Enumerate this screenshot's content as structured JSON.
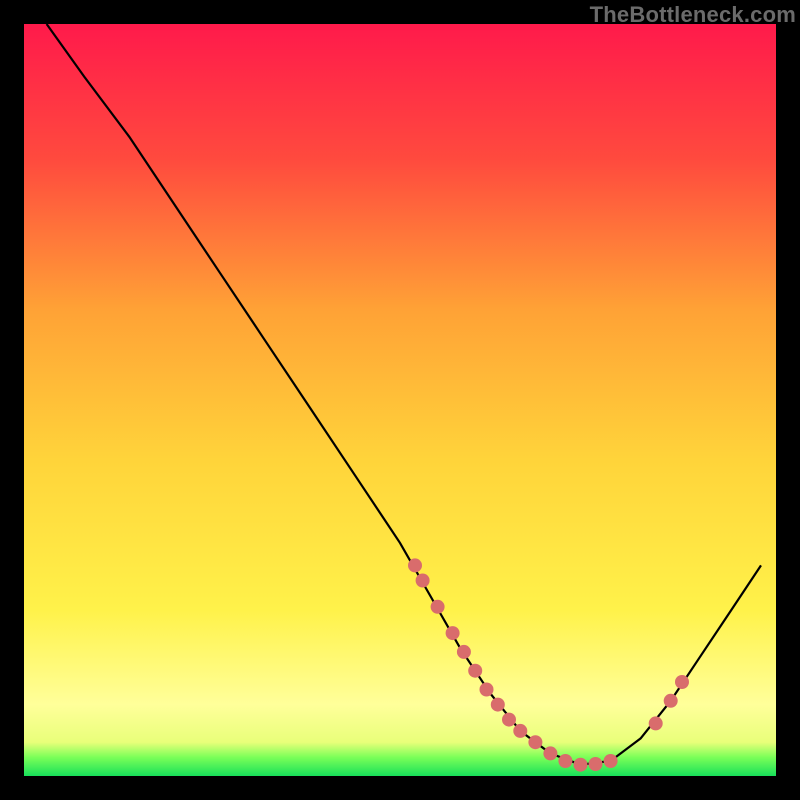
{
  "watermark": "TheBottleneck.com",
  "colors": {
    "gradient_stops": [
      {
        "offset": 0.0,
        "color": "#ff1a4b"
      },
      {
        "offset": 0.18,
        "color": "#ff4a3e"
      },
      {
        "offset": 0.38,
        "color": "#ffa236"
      },
      {
        "offset": 0.58,
        "color": "#ffd43a"
      },
      {
        "offset": 0.78,
        "color": "#fff24a"
      },
      {
        "offset": 0.905,
        "color": "#ffff9a"
      },
      {
        "offset": 0.955,
        "color": "#e9ff7a"
      },
      {
        "offset": 0.975,
        "color": "#7bff58"
      },
      {
        "offset": 1.0,
        "color": "#18e05a"
      }
    ],
    "curve": "#000000",
    "marker": "#d96c6c",
    "frame_bg": "#000000"
  },
  "chart_data": {
    "type": "line",
    "title": "",
    "xlabel": "",
    "ylabel": "",
    "xlim": [
      0,
      100
    ],
    "ylim": [
      0,
      100
    ],
    "grid": false,
    "curve": [
      {
        "x": 3,
        "y": 100
      },
      {
        "x": 8,
        "y": 93
      },
      {
        "x": 14,
        "y": 85
      },
      {
        "x": 20,
        "y": 76
      },
      {
        "x": 26,
        "y": 67
      },
      {
        "x": 32,
        "y": 58
      },
      {
        "x": 38,
        "y": 49
      },
      {
        "x": 44,
        "y": 40
      },
      {
        "x": 50,
        "y": 31
      },
      {
        "x": 54,
        "y": 24
      },
      {
        "x": 58,
        "y": 17
      },
      {
        "x": 62,
        "y": 11
      },
      {
        "x": 66,
        "y": 6
      },
      {
        "x": 70,
        "y": 3
      },
      {
        "x": 74,
        "y": 1.5
      },
      {
        "x": 78,
        "y": 2
      },
      {
        "x": 82,
        "y": 5
      },
      {
        "x": 86,
        "y": 10
      },
      {
        "x": 90,
        "y": 16
      },
      {
        "x": 94,
        "y": 22
      },
      {
        "x": 98,
        "y": 28
      }
    ],
    "markers": [
      {
        "x": 52,
        "y": 28
      },
      {
        "x": 53,
        "y": 26
      },
      {
        "x": 55,
        "y": 22.5
      },
      {
        "x": 57,
        "y": 19
      },
      {
        "x": 58.5,
        "y": 16.5
      },
      {
        "x": 60,
        "y": 14
      },
      {
        "x": 61.5,
        "y": 11.5
      },
      {
        "x": 63,
        "y": 9.5
      },
      {
        "x": 64.5,
        "y": 7.5
      },
      {
        "x": 66,
        "y": 6
      },
      {
        "x": 68,
        "y": 4.5
      },
      {
        "x": 70,
        "y": 3
      },
      {
        "x": 72,
        "y": 2
      },
      {
        "x": 74,
        "y": 1.5
      },
      {
        "x": 76,
        "y": 1.6
      },
      {
        "x": 78,
        "y": 2
      },
      {
        "x": 84,
        "y": 7
      },
      {
        "x": 86,
        "y": 10
      },
      {
        "x": 87.5,
        "y": 12.5
      }
    ],
    "marker_radius": 7
  }
}
